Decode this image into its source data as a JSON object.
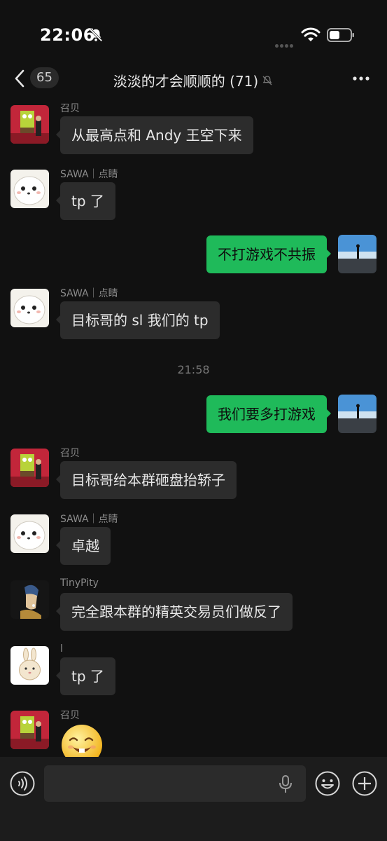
{
  "status_bar": {
    "time": "22:06"
  },
  "nav": {
    "unread_count": "65",
    "title": "淡淡的才会顺顺的 (71)"
  },
  "messages": [
    {
      "sender": "召贝",
      "text": "从最高点和 Andy 王空下来",
      "avatar": "spongebob-photo"
    },
    {
      "sender": "SAWA｜点睛",
      "text": "tp 了",
      "avatar": "white-bun"
    },
    {
      "text": "不打游戏不共振",
      "avatar": "ocean-photo"
    },
    {
      "sender": "SAWA｜点睛",
      "text": "目标哥的 sl 我们的 tp",
      "avatar": "white-bun"
    },
    {
      "timestamp": "21:58"
    },
    {
      "text": "我们要多打游戏",
      "avatar": "ocean-photo"
    },
    {
      "sender": "召贝",
      "text": "目标哥给本群砸盘抬轿子",
      "avatar": "spongebob-photo"
    },
    {
      "sender": "SAWA｜点睛",
      "text": "卓越",
      "avatar": "white-bun"
    },
    {
      "sender": "TinyPity",
      "text": "完全跟本群的精英交易员们做反了",
      "avatar": "pearl-earring-painting"
    },
    {
      "sender": "l",
      "text": "tp 了",
      "avatar": "bunny-cartoon"
    },
    {
      "sender": "召贝",
      "sticker": "grinning-face-sticker",
      "avatar": "spongebob-photo"
    }
  ],
  "input": {
    "placeholder": ""
  },
  "colors": {
    "background": "#111111",
    "bubble_in": "#2c2c2c",
    "bubble_out": "#1fba5a",
    "input_bar": "#1c1c1c"
  }
}
